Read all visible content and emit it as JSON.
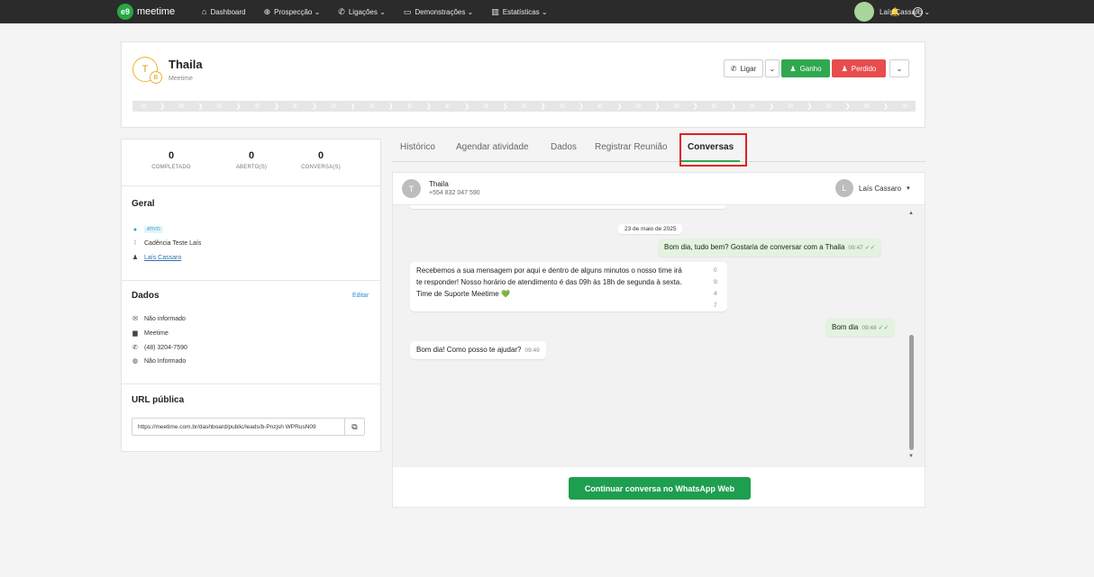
{
  "nav": {
    "logo_mark": "e9",
    "logo_text": "meetime",
    "menu": [
      {
        "label": "Dashboard",
        "icon": "⌂"
      },
      {
        "label": "Prospecção ⌄",
        "icon": "⊕"
      },
      {
        "label": "Ligações ⌄",
        "icon": "✆"
      },
      {
        "label": "Demonstrações ⌄",
        "icon": "▭"
      },
      {
        "label": "Estatísticas ⌄",
        "icon": "▥"
      }
    ],
    "bell_icon": "🔔",
    "help_icon": "?",
    "user_name": "Laís Cassaro ⌄"
  },
  "lead": {
    "initial": "T",
    "badge": "B",
    "name": "Thaila",
    "company": "Meetime",
    "actions": {
      "call_label": "Ligar",
      "call_caret": "⌄",
      "won_label": "Ganho",
      "lost_label": "Perdido",
      "more_caret": "⌄"
    },
    "cadence_icons": [
      "✉",
      "❯",
      "✉",
      "❯",
      "✉",
      "❯",
      "✆",
      "❯",
      "✆",
      "❯",
      "✉",
      "❯",
      "✉",
      "❯",
      "✆",
      "❯",
      "✆",
      "❯",
      "✉",
      "❯",
      "✉",
      "❯",
      "✉",
      "❯",
      "✆",
      "❯",
      "✉",
      "❯",
      "✉",
      "❯",
      "✆",
      "❯",
      "✉",
      "❯",
      "✉",
      "❯",
      "✉",
      "❯",
      "✉",
      "❯",
      "✉"
    ]
  },
  "stats": [
    {
      "num": "0",
      "label": "COMPLETADO"
    },
    {
      "num": "0",
      "label": "ABERTO(S)"
    },
    {
      "num": "0",
      "label": "CONVERSA(S)"
    }
  ],
  "geral": {
    "title": "Geral",
    "status": "ATIVO",
    "cadence": "Cadência Teste Laís",
    "owner": "Laís Cassaro"
  },
  "dados": {
    "title": "Dados",
    "edit_label": "Editar",
    "email": "Não informado",
    "company": "Meetime",
    "phone": "(48) 3204-7590",
    "site": "Não Informado"
  },
  "url": {
    "title": "URL pública",
    "value": "https://meetime.com.br/dashboard/public/leads/b-Pnzjsh WPRusN09",
    "copy_icon": "⧉"
  },
  "tabs": [
    {
      "label": "Histórico"
    },
    {
      "label": "Agendar atividade"
    },
    {
      "label": "Dados"
    },
    {
      "label": "Registrar Reunião"
    },
    {
      "label": "Conversas"
    }
  ],
  "chat": {
    "contact_initial": "T",
    "contact_name": "Thaila",
    "contact_phone": "+554 832 047 590",
    "agent_initial": "L",
    "agent_name": "Laís Cassaro",
    "agent_caret": "▾",
    "date_chip": "23 de maio de 2025",
    "msg1_text": "Bom dia, tudo bem? Gostaria de conversar com a Thaila",
    "msg1_time": "09:47",
    "msg2_line1": "Recebemos a sua mensagem por aqui e dentro de alguns minutos o nosso time irá",
    "msg2_line2": "te responder! Nosso horário de atendimento é das 09h às 18h de segunda à sexta.",
    "msg2_line3": "Time de Suporte Meetime 💚",
    "msg2_side": [
      "0",
      "9:",
      "4",
      "7"
    ],
    "msg3_text": "Bom dia",
    "msg3_time": "09:48",
    "msg4_text": "Bom dia! Como posso te ajudar?",
    "msg4_time": "09:49",
    "check": "✓✓",
    "whatsapp_button": "Continuar conversa no WhatsApp Web"
  }
}
